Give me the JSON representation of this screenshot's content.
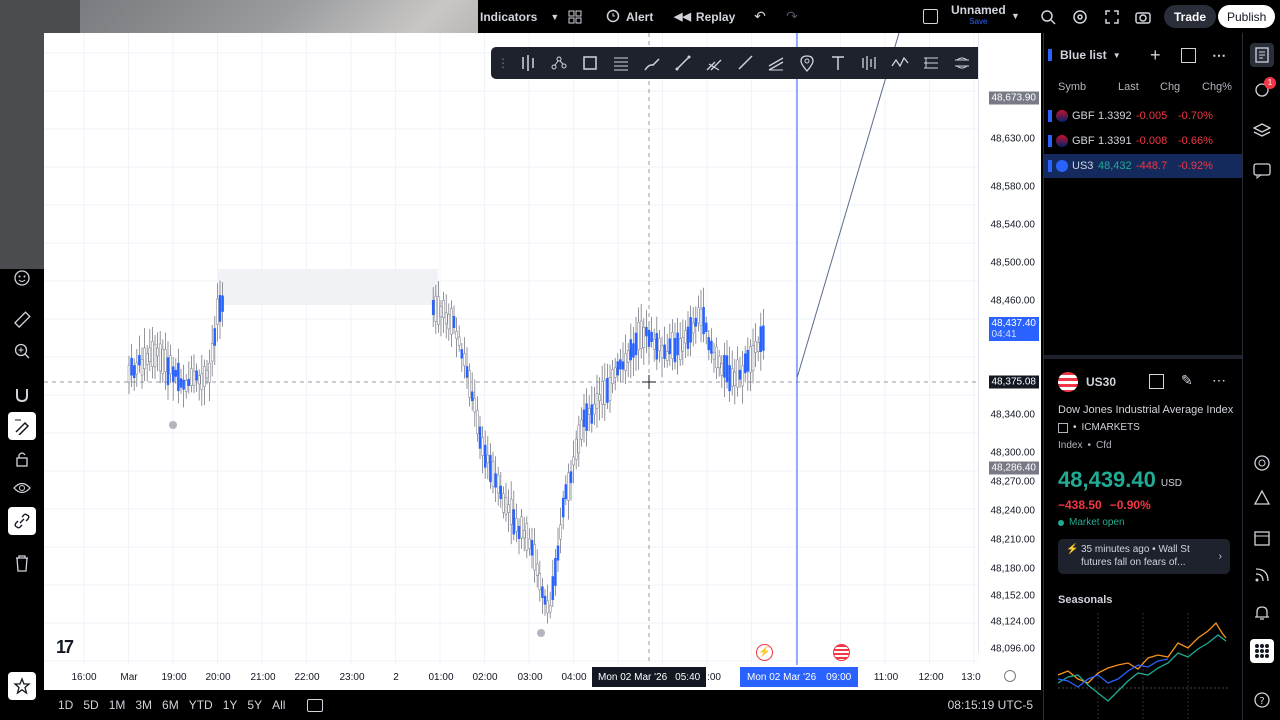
{
  "topbar": {
    "indicators": "Indicators",
    "alert": "Alert",
    "replay": "Replay",
    "layout_name": "Unnamed",
    "save": "Save",
    "trade": "Trade",
    "publish": "Publish"
  },
  "price_scale": {
    "labels": [
      "48,630.00",
      "48,580.00",
      "48,540.00",
      "48,500.00",
      "48,460.00",
      "48,340.00",
      "48,300.00",
      "48,270.00",
      "48,240.00",
      "48,210.00",
      "48,180.00",
      "48,152.00",
      "48,124.00",
      "48,096.00"
    ],
    "tag_top": "48,673.90",
    "tag_current_price": "48,437.40",
    "tag_current_time": "04:41",
    "tag_crosshair": "48,375.08",
    "tag_low": "48,286.40"
  },
  "time_scale": {
    "labels": [
      "16:00",
      "Mar",
      "19:00",
      "20:00",
      "21:00",
      "22:00",
      "23:00",
      "2",
      "01:00",
      "02:00",
      "03:00",
      "04:00",
      "05:40",
      ":00",
      "11:00",
      "12:00",
      "13:0"
    ],
    "crosshair_label": "Mon 02 Mar '26",
    "crosshair_time": "05:40",
    "marker_label": "Mon 02 Mar '26",
    "marker_time": "09:00"
  },
  "bottombar": {
    "ranges": [
      "1D",
      "5D",
      "1M",
      "3M",
      "6M",
      "YTD",
      "1Y",
      "5Y",
      "All"
    ],
    "clock": "08:15:19 UTC-5"
  },
  "watchlist": {
    "title": "Blue list",
    "columns": [
      "Symb",
      "Last",
      "Chg",
      "Chg%"
    ],
    "rows": [
      {
        "symbol": "GBF",
        "last": "1.3392",
        "chg": "-0.005",
        "chgp": "-0.70%"
      },
      {
        "symbol": "GBF",
        "last": "1.3391",
        "chg": "-0.008",
        "chgp": "-0.66%"
      },
      {
        "symbol": "US3",
        "last": "48,432",
        "chg": "-448.7",
        "chgp": "-0.92%"
      }
    ]
  },
  "details": {
    "symbol": "US30",
    "name": "Dow Jones Industrial Average Index",
    "exchange": "ICMARKETS",
    "type": "Index",
    "subtype": "Cfd",
    "price": "48,439.40",
    "currency": "USD",
    "change": "−438.50",
    "change_pct": "−0.90%",
    "market_status": "Market open",
    "news_time": "35 minutes ago",
    "news_source": "Wall St",
    "news_text": "futures fall on fears of...",
    "seasonals": "Seasonals"
  },
  "rail": {
    "alert_count": "1"
  },
  "colors": {
    "accent": "#2962ff",
    "down": "#f23645",
    "up": "#22ab94",
    "candle_up": "#2962ff",
    "candle_down": "#ffffff"
  }
}
